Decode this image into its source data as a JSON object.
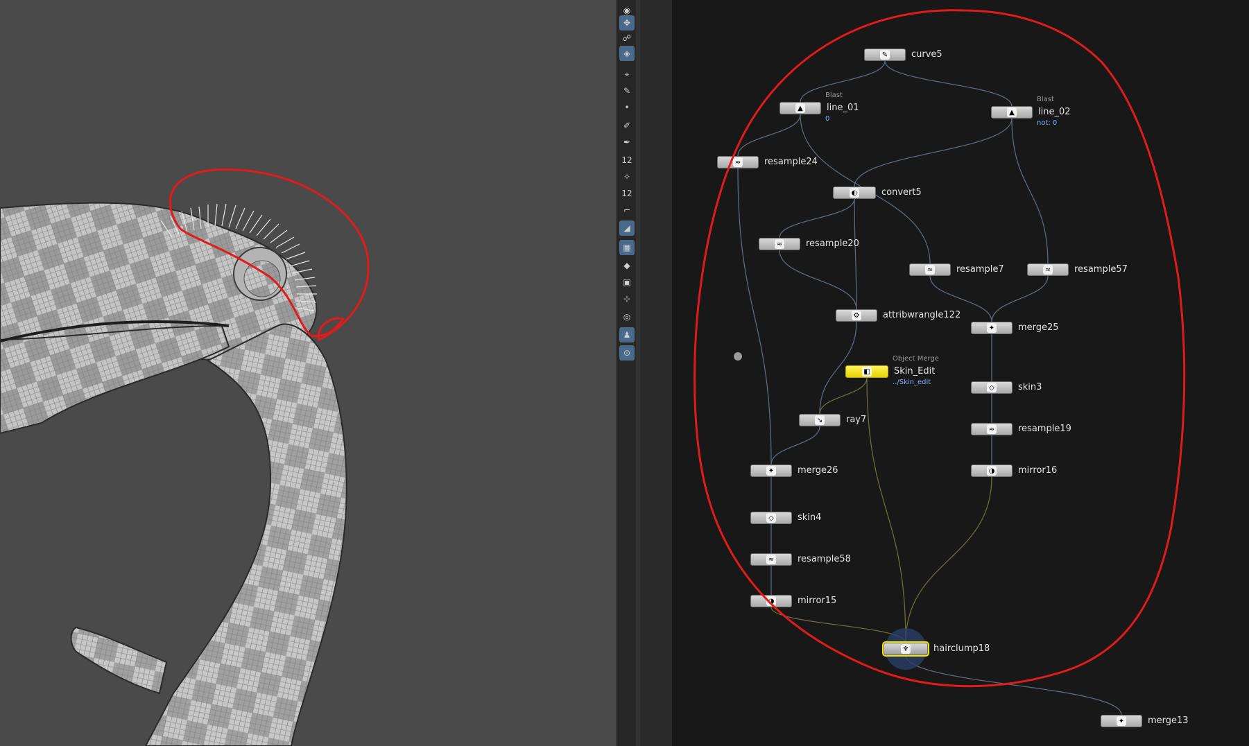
{
  "toolbar": {
    "tools": [
      {
        "name": "select-tool-icon",
        "glyph": "◉",
        "active": false
      },
      {
        "name": "handle-tool-icon",
        "glyph": "✥",
        "active": true
      },
      {
        "name": "camera-tool-icon",
        "glyph": "☍",
        "active": false
      },
      {
        "name": "view-tool-icon",
        "glyph": "◈",
        "active": true
      },
      {
        "name": "pose-tool-icon",
        "glyph": "⌖",
        "active": false
      },
      {
        "name": "paint-tool-icon",
        "glyph": "✎",
        "active": false
      },
      {
        "name": "point-tool-icon",
        "glyph": "•",
        "active": false
      },
      {
        "name": "brush-tool-icon",
        "glyph": "✐",
        "active": false
      },
      {
        "name": "pen-tool-icon",
        "glyph": "✒",
        "active": false
      },
      {
        "name": "count-tool-icon",
        "glyph": "12",
        "active": false
      },
      {
        "name": "clump-tool-icon",
        "glyph": "✧",
        "active": false
      },
      {
        "name": "count2-tool-icon",
        "glyph": "12",
        "active": false
      },
      {
        "name": "corner-tool-icon",
        "glyph": "⌐",
        "active": false
      },
      {
        "name": "groom-tool-icon",
        "glyph": "◢",
        "active": true
      },
      {
        "name": "grid-tool-icon",
        "glyph": "▦",
        "active": true
      },
      {
        "name": "diamond-tool-icon",
        "glyph": "◆",
        "active": false
      },
      {
        "name": "map-tool-icon",
        "glyph": "▣",
        "active": false
      },
      {
        "name": "snap-tool-icon",
        "glyph": "⊹",
        "active": false
      },
      {
        "name": "record-tool-icon",
        "glyph": "◎",
        "active": false
      },
      {
        "name": "figure-tool-icon",
        "glyph": "♟",
        "active": true
      },
      {
        "name": "pin-tool-icon",
        "glyph": "⊙",
        "active": true
      }
    ]
  },
  "network": {
    "nodes": [
      {
        "id": "curve5",
        "label": "curve5",
        "icon": "✎"
      },
      {
        "id": "line_01",
        "label": "line_01",
        "type": "Blast",
        "info": "0",
        "icon": "▲"
      },
      {
        "id": "line_02",
        "label": "line_02",
        "type": "Blast",
        "info": "not: 0",
        "icon": "▲"
      },
      {
        "id": "resample24",
        "label": "resample24",
        "icon": "≈"
      },
      {
        "id": "convert5",
        "label": "convert5",
        "icon": "◐"
      },
      {
        "id": "resample20",
        "label": "resample20",
        "icon": "≈"
      },
      {
        "id": "resample7",
        "label": "resample7",
        "icon": "≈"
      },
      {
        "id": "resample57",
        "label": "resample57",
        "icon": "≈"
      },
      {
        "id": "attribwrangle122",
        "label": "attribwrangle122",
        "icon": "⚙"
      },
      {
        "id": "merge25",
        "label": "merge25",
        "icon": "✦"
      },
      {
        "id": "Skin_Edit",
        "label": "Skin_Edit",
        "type": "Object Merge",
        "info": "../Skin_edit",
        "icon": "◧"
      },
      {
        "id": "skin3",
        "label": "skin3",
        "icon": "◇"
      },
      {
        "id": "ray7",
        "label": "ray7",
        "icon": "↘"
      },
      {
        "id": "resample19",
        "label": "resample19",
        "icon": "≈"
      },
      {
        "id": "merge26",
        "label": "merge26",
        "icon": "✦"
      },
      {
        "id": "mirror16",
        "label": "mirror16",
        "icon": "◑"
      },
      {
        "id": "skin4",
        "label": "skin4",
        "icon": "◇"
      },
      {
        "id": "resample58",
        "label": "resample58",
        "icon": "≈"
      },
      {
        "id": "mirror15",
        "label": "mirror15",
        "icon": "◑"
      },
      {
        "id": "hairclump18",
        "label": "hairclump18",
        "icon": "♆"
      },
      {
        "id": "merge13",
        "label": "merge13",
        "icon": "✦"
      }
    ]
  },
  "colors": {
    "annotation": "#e01b1b",
    "selected": "#f2e600",
    "viewport_bg": "#4a4a4a",
    "network_bg": "#181818",
    "wire": "#5a6a80",
    "info": "#7fb2ff"
  }
}
